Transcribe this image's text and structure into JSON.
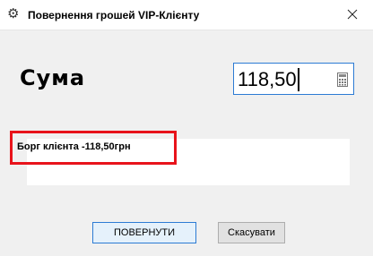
{
  "window": {
    "title": "Повернення грошей VIP-Клієнту",
    "title_icon": "gear-icon",
    "close_icon": "close-icon"
  },
  "form": {
    "sum_label": "Сума",
    "sum_value": "118,50",
    "calculator_icon": "calculator-icon"
  },
  "info": {
    "debt_text": "Борг клієнта -118,50грн"
  },
  "buttons": {
    "return_label": "ПОВЕРНУТИ",
    "cancel_label": "Скасувати"
  },
  "colors": {
    "highlight": "#e8131b",
    "focus_border": "#2c7bd4"
  }
}
